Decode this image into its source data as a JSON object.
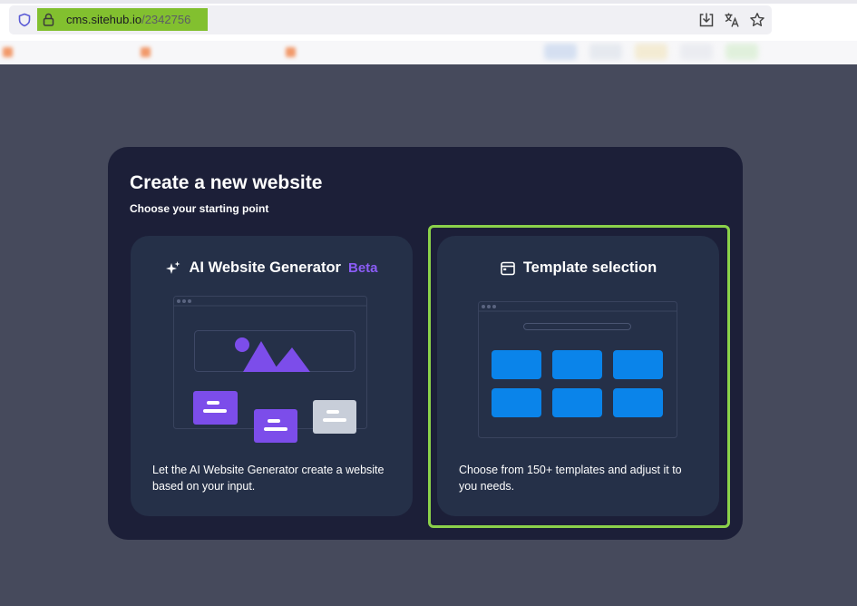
{
  "browser": {
    "url_domain": "cms.sitehub.io",
    "url_path": "/2342756",
    "icons": [
      "shield-icon",
      "lock-icon",
      "download-icon",
      "translate-icon",
      "star-icon"
    ],
    "highlight_color": "#82c02f"
  },
  "modal": {
    "title": "Create a new website",
    "subtitle": "Choose your starting point"
  },
  "cards": {
    "ai": {
      "title": "AI Website Generator",
      "badge": "Beta",
      "icon": "sparkle-icon",
      "description": "Let the AI Website Generator create a website based on your input."
    },
    "template": {
      "title": "Template selection",
      "icon": "browser-window-icon",
      "description": "Choose from 150+ templates and adjust it to you needs.",
      "selected": true
    }
  },
  "colors": {
    "page_bg": "#464a5c",
    "modal_bg": "#1c1f38",
    "card_bg": "#253048",
    "accent_purple": "#7c4dea",
    "accent_blue": "#0a84ea",
    "selection_green": "#8bd14a"
  }
}
